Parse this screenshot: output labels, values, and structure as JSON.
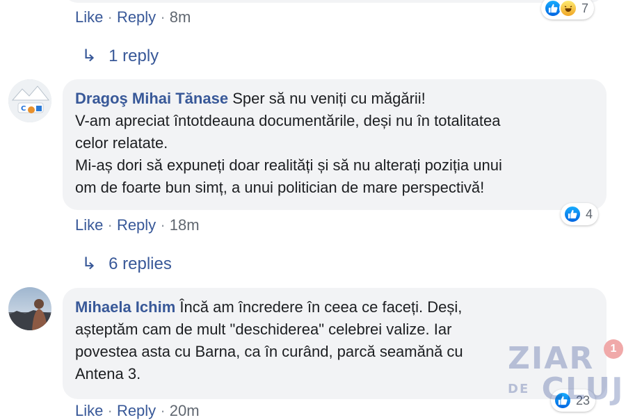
{
  "comments": [
    {
      "actions": {
        "like": "Like",
        "reply": "Reply",
        "time": "8m"
      },
      "reactions": {
        "count": "7"
      },
      "replies": "1 reply"
    },
    {
      "author": "Dragoş Mihai Tănase",
      "text_lines": [
        "Sper să nu veniți cu măgării!",
        "V-am apreciat întotdeauna documentările, deși nu în totalitatea",
        "celor relatate.",
        "Mi-aș dori să expuneți doar realități și să nu alterați poziția unui",
        "om de foarte bun simț, a unui politician de mare perspectivă!"
      ],
      "actions": {
        "like": "Like",
        "reply": "Reply",
        "time": "18m"
      },
      "reactions": {
        "count": "4"
      },
      "replies": "6 replies"
    },
    {
      "author": "Mihaela Ichim",
      "text_lines": [
        "Încă am încredere în ceea ce faceți. Deși,",
        "așteptăm cam de mult \"deschiderea\" celebrei valize. Iar",
        "povestea asta cu Barna, ca în curând, parcă seamănă cu",
        "Antena 3."
      ],
      "actions": {
        "like": "Like",
        "reply": "Reply",
        "time": "20m"
      },
      "reactions": {
        "count": "23"
      }
    }
  ],
  "watermark": {
    "line1": "ZIAR",
    "line2a": "DE",
    "line2b": "CLUJ",
    "badge": "1"
  },
  "separator": "·",
  "icons": {
    "reply_arrow": "reply-arrow-icon",
    "like": "like-reaction-icon",
    "haha": "haha-reaction-icon"
  }
}
